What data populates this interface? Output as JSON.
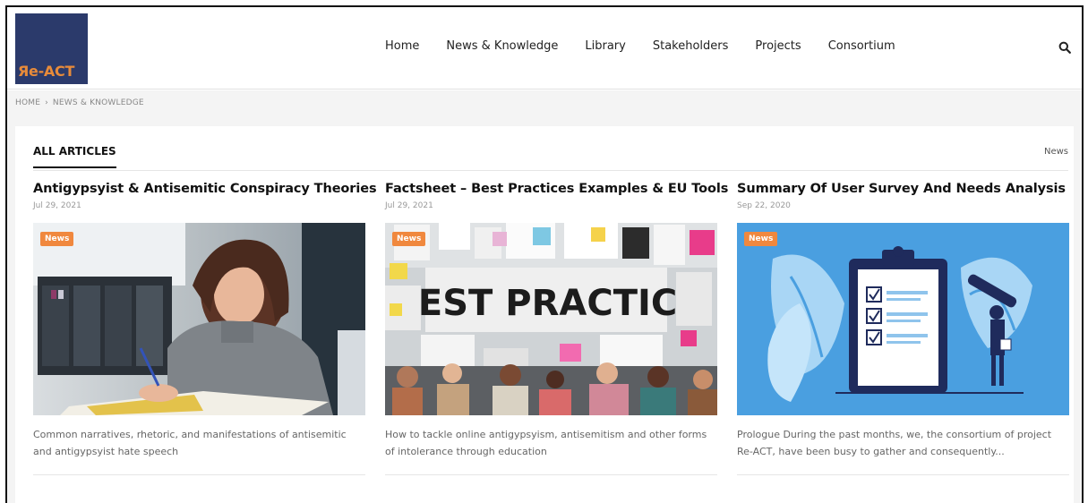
{
  "header": {
    "logo_text": "Яe-ACT",
    "nav": [
      "Home",
      "News & Knowledge",
      "Library",
      "Stakeholders",
      "Projects",
      "Consortium"
    ],
    "search_icon": "search-icon"
  },
  "breadcrumb": {
    "home": "HOME",
    "separator": "›",
    "current": "NEWS & KNOWLEDGE"
  },
  "section": {
    "title": "ALL ARTICLES",
    "filter": "News"
  },
  "articles": [
    {
      "title": "Antigypsyist & Antisemitic Conspiracy Theories",
      "date": "Jul 29, 2021",
      "badge": "News",
      "image": "woman-studying-library",
      "excerpt": "Common narratives, rhetoric, and manifestations of antisemitic and antigypsyist hate speech"
    },
    {
      "title": "Factsheet – Best Practices Examples & EU Tools",
      "date": "Jul 29, 2021",
      "badge": "News",
      "image": "best-practice-board-team",
      "image_text": "BEST PRACTICE",
      "excerpt": "How to tackle online antigypsyism, antisemitism and other forms of intolerance through education"
    },
    {
      "title": "Summary Of User Survey And Needs Analysis",
      "date": "Sep 22, 2020",
      "badge": "News",
      "image": "clipboard-checklist-illustration",
      "excerpt": "Prologue During the past months, we, the consortium of project Re-ACT, have been busy to gather and consequently..."
    }
  ],
  "colors": {
    "logo_bg": "#2b3a6b",
    "logo_text": "#e88b3a",
    "badge": "#f0883e",
    "illustration_bg": "#4a9fe0"
  }
}
